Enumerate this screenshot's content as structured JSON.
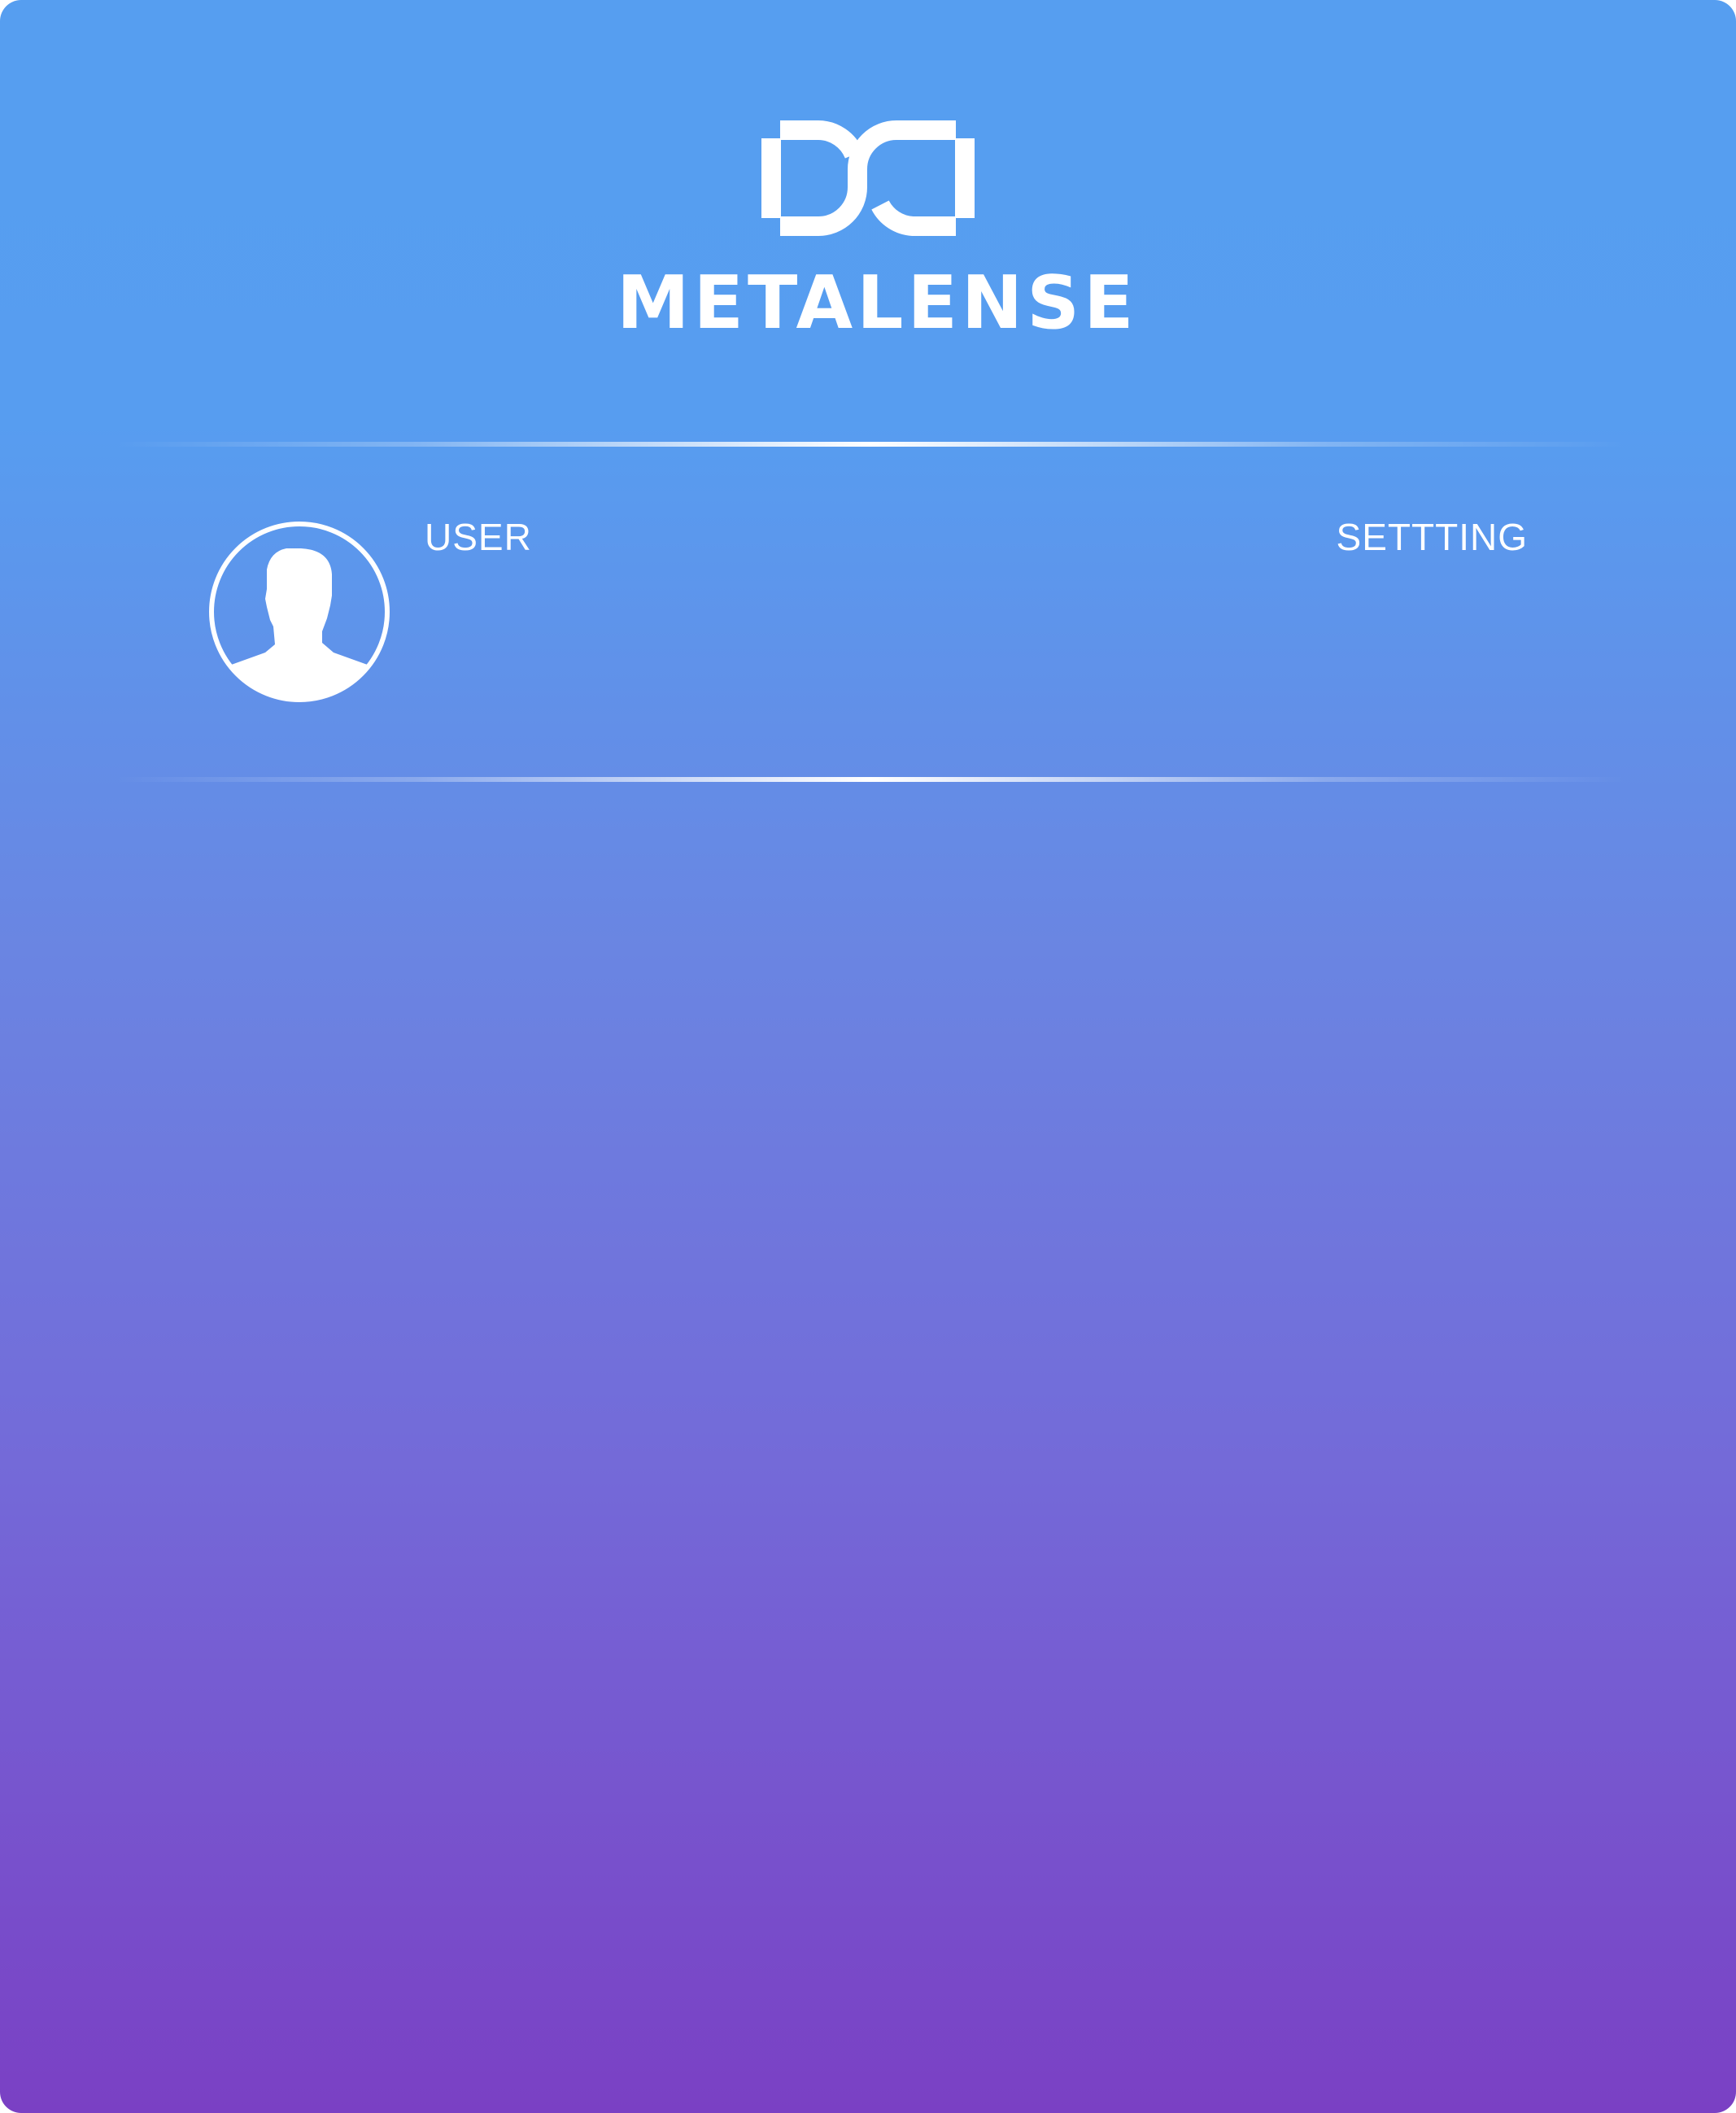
{
  "brand": {
    "name": "METALENSE",
    "logo_icon": "metalense-logo-icon"
  },
  "user_section": {
    "avatar_icon": "user-avatar-icon",
    "user_label": "USER",
    "setting_label": "SETTTING"
  },
  "colors": {
    "gradient_top": "#569ef0",
    "gradient_bottom": "#7a40c4",
    "foreground": "#ffffff"
  }
}
